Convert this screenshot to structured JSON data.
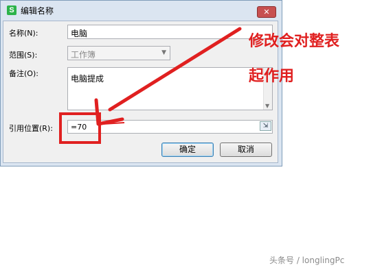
{
  "dialog": {
    "title": "编辑名称",
    "app_icon_letter": "S",
    "close_glyph": "✕",
    "name_label": "名称(N):",
    "name_value": "电脑",
    "scope_label": "范围(S):",
    "scope_value": "工作簿",
    "comment_label": "备注(O):",
    "comment_value": "电脑提成",
    "ref_label": "引用位置(R):",
    "ref_value": "=70",
    "ok_label": "确定",
    "cancel_label": "取消"
  },
  "annotation": {
    "line1": "修改会对整表",
    "line2": "起作用",
    "color": "#e02020"
  },
  "watermark": "头条号 / longlingPc"
}
